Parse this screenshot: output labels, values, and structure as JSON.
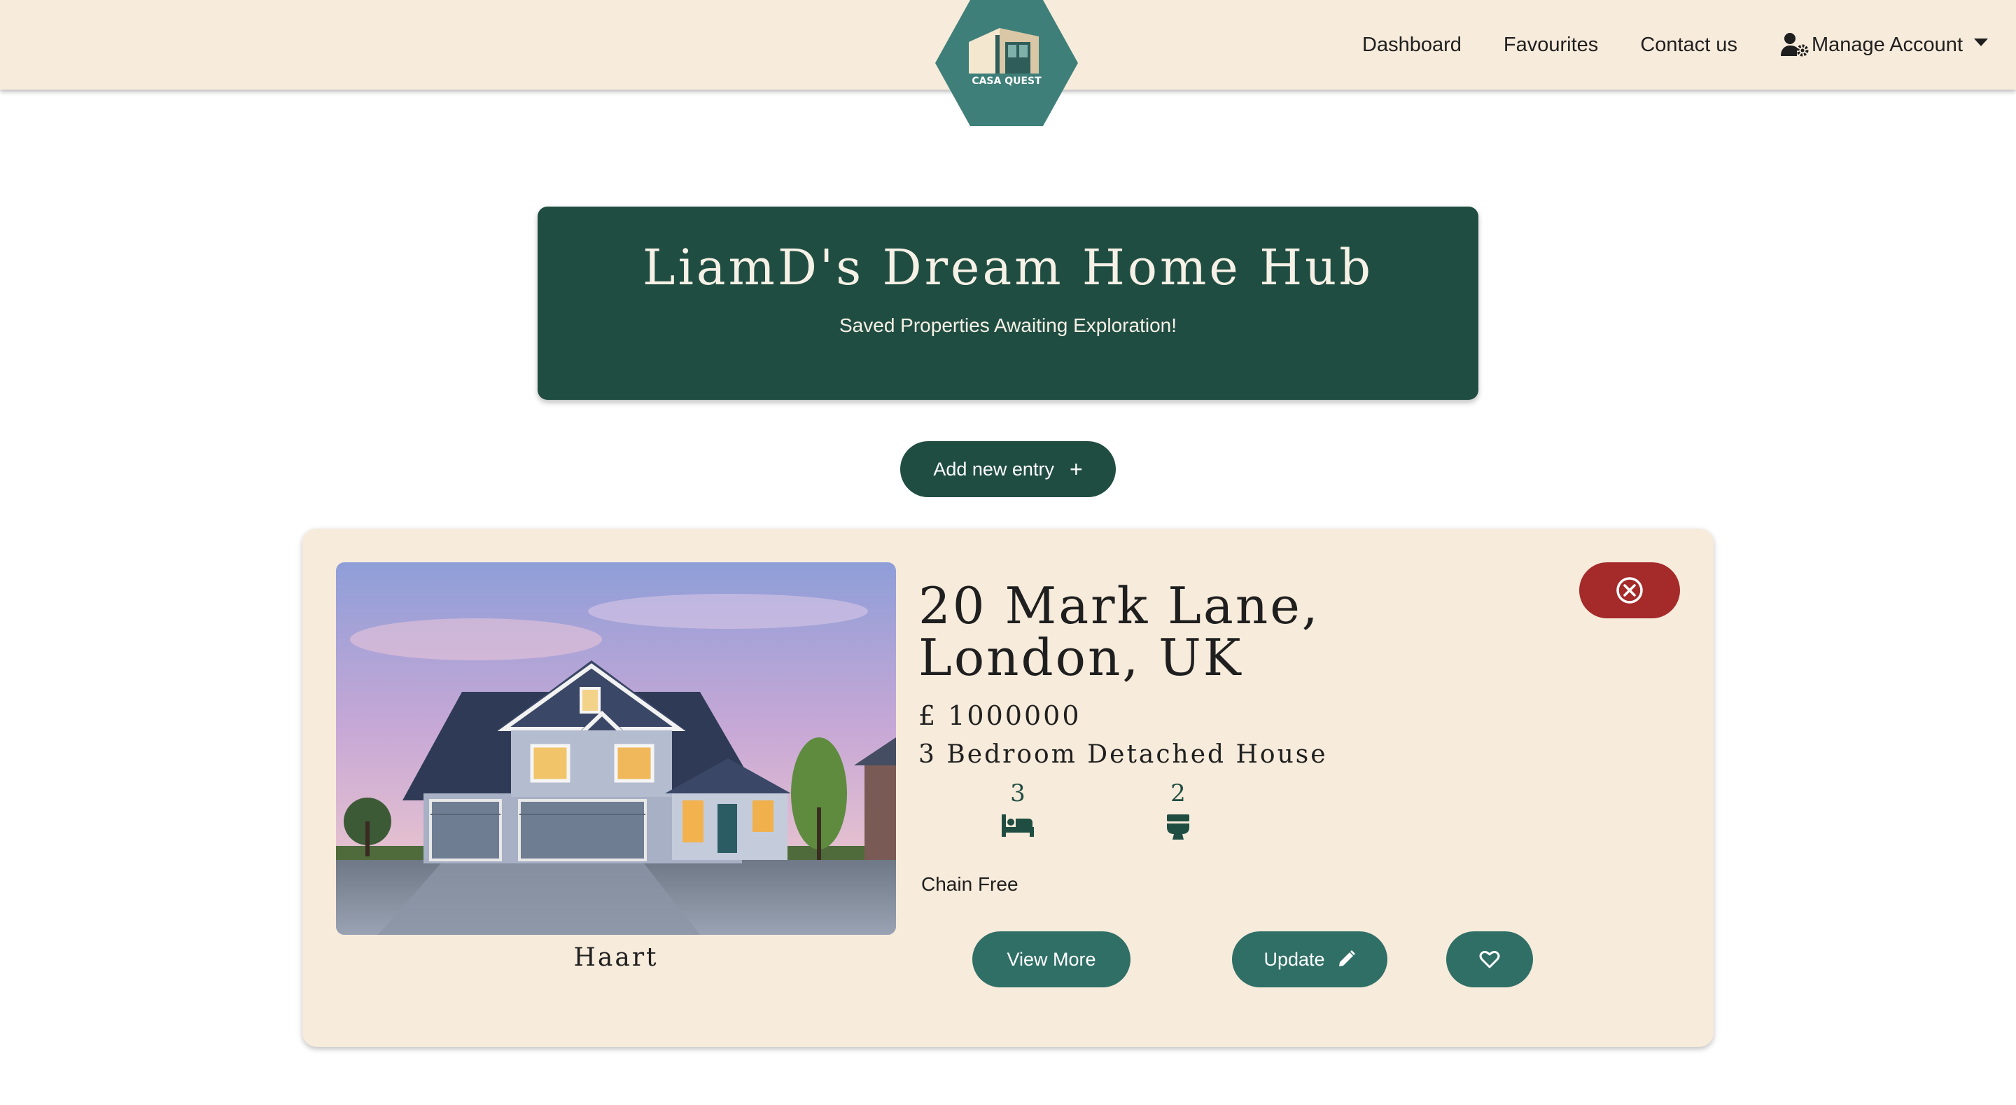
{
  "nav": {
    "logo_text": "CASA QUEST",
    "links": [
      "Dashboard",
      "Favourites",
      "Contact us"
    ],
    "account_label": "Manage Account",
    "account_icon": "user-gear-icon"
  },
  "hero": {
    "title": "LiamD's Dream Home Hub",
    "subtitle": "Saved Properties Awaiting Exploration!"
  },
  "add_button": {
    "label": "Add new entry",
    "icon": "+"
  },
  "property": {
    "address": "20 Mark Lane, London, UK",
    "price": "£ 1000000",
    "type": "3 Bedroom Detached House",
    "bedrooms": "3",
    "bathrooms": "2",
    "chain": "Chain Free",
    "agent": "Haart",
    "view_label": "View More",
    "update_label": "Update"
  },
  "colors": {
    "nav_bg": "#f7ebdb",
    "hero_bg": "#204d42",
    "button_teal": "#2f6f66",
    "delete_red": "#a52a2a",
    "card_bg": "#f7ebdb"
  }
}
